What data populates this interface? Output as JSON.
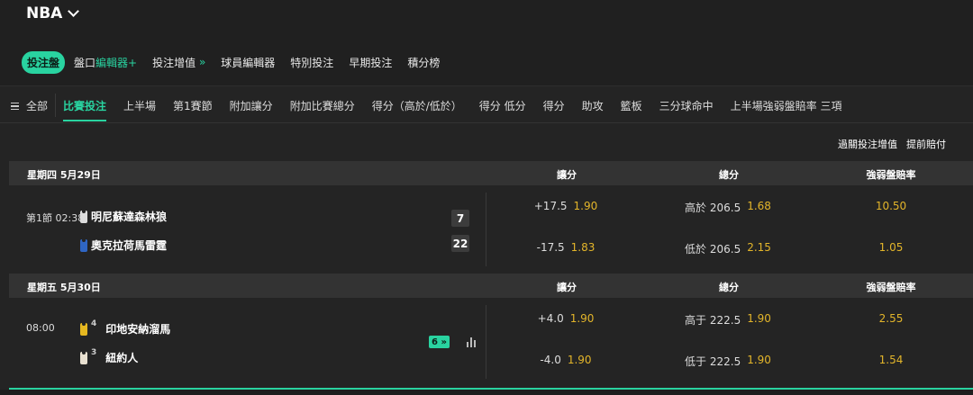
{
  "league": {
    "title": "NBA"
  },
  "main_tabs": [
    {
      "label": "投注盤"
    },
    {
      "label": "盤口",
      "accent": "編輯器+"
    },
    {
      "label": "投注增值",
      "accent": "»"
    },
    {
      "label": "球員編輯器"
    },
    {
      "label": "特別投注"
    },
    {
      "label": "早期投注"
    },
    {
      "label": "積分榜"
    }
  ],
  "sub_nav": {
    "all_label": "全部",
    "tabs": [
      "比賽投注",
      "上半場",
      "第1賽節",
      "附加讓分",
      "附加比賽總分",
      "得分（高於/低於）",
      "得分 低分",
      "得分",
      "助攻",
      "籃板",
      "三分球命中",
      "上半場強弱盤賠率 三項"
    ]
  },
  "links": [
    "過關投注增值",
    "提前賠付"
  ],
  "colors": {
    "accent": "#29d3a0",
    "odds": "#e3b52a",
    "background": "#242424",
    "header_row": "#333333"
  },
  "days": [
    {
      "date": "星期四 5月29日",
      "cols": [
        "讓分",
        "總分",
        "強弱盤賠率"
      ],
      "game": {
        "time": "第1節 02:38",
        "teams": [
          {
            "name": "明尼蘇達森林狼",
            "jersey_color": "#dcdcdc",
            "score": "7"
          },
          {
            "name": "奧克拉荷馬雷霆",
            "jersey_color": "#2f66c4",
            "score": "22"
          }
        ],
        "spread": [
          {
            "line": "+17.5",
            "price": "1.90"
          },
          {
            "line": "-17.5",
            "price": "1.83"
          }
        ],
        "total": [
          {
            "line": "高於 206.5",
            "price": "1.68"
          },
          {
            "line": "低於 206.5",
            "price": "2.15"
          }
        ],
        "moneyline": [
          "10.50",
          "1.05"
        ]
      }
    },
    {
      "date": "星期五 5月30日",
      "cols": [
        "讓分",
        "總分",
        "強弱盤賠率"
      ],
      "game": {
        "time": "08:00",
        "teams": [
          {
            "name": "印地安納溜馬",
            "jersey_color": "#e6b820",
            "seed": "4"
          },
          {
            "name": "紐約人",
            "jersey_color": "#e8e0d0",
            "seed": "3"
          }
        ],
        "more_markets": "6 »",
        "spread": [
          {
            "line": "+4.0",
            "price": "1.90"
          },
          {
            "line": "-4.0",
            "price": "1.90"
          }
        ],
        "total": [
          {
            "line": "高于 222.5",
            "price": "1.90"
          },
          {
            "line": "低于 222.5",
            "price": "1.90"
          }
        ],
        "moneyline": [
          "2.55",
          "1.54"
        ]
      }
    }
  ]
}
